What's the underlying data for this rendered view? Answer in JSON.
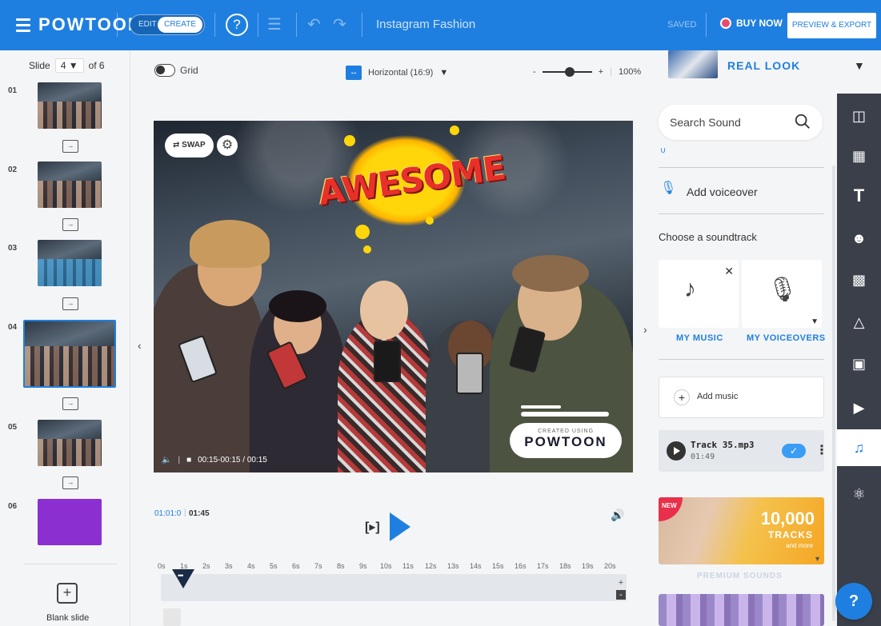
{
  "topbar": {
    "logo": "POWTOON",
    "mode_edit": "EDIT",
    "mode_create": "CREATE",
    "help": "?",
    "project_title": "Instagram Fashion",
    "saved": "SAVED",
    "buy_now": "BUY NOW",
    "preview_export": "PREVIEW & EXPORT",
    "brand_color": "#1f7fe0"
  },
  "slides": {
    "label": "Slide",
    "current": "4 ▼",
    "of": "of 6",
    "items": [
      {
        "num": "01",
        "style": "photo"
      },
      {
        "num": "02",
        "style": "photo"
      },
      {
        "num": "03",
        "style": "photo"
      },
      {
        "num": "04",
        "style": "photo",
        "active": true
      },
      {
        "num": "05",
        "style": "photo"
      },
      {
        "num": "06",
        "style": "purple"
      }
    ],
    "blank_slide": "Blank slide"
  },
  "canvas": {
    "grid_label": "Grid",
    "orientation": "Horizontal (16:9)",
    "zoom_minus": "-",
    "zoom_plus": "+",
    "zoom_value": "100%",
    "swap_label": "SWAP",
    "awesome_text": "AWESOME",
    "time_range": "00:15-00:15 / 00:15",
    "watermark_small": "CREATED USING",
    "watermark_big": "POWTOON"
  },
  "timeline": {
    "current": "01:01:0",
    "total": "01:45",
    "ticks": [
      "0s",
      "1s",
      "2s",
      "3s",
      "4s",
      "5s",
      "6s",
      "7s",
      "8s",
      "9s",
      "10s",
      "11s",
      "12s",
      "13s",
      "14s",
      "15s",
      "16s",
      "17s",
      "18s",
      "19s",
      "20s"
    ]
  },
  "right_panel": {
    "title": "REAL LOOK",
    "search_placeholder": "Search Sound",
    "add_voiceover": "Add voiceover",
    "choose_soundtrack": "Choose a soundtrack",
    "my_music": "MY MUSIC",
    "my_voiceovers": "MY VOICEOVERS",
    "add_music": "Add music",
    "track_name": "Track 35.mp3",
    "track_time": "01:49",
    "promo_new": "NEW",
    "promo_big": "10,000",
    "promo_sub": "TRACKS",
    "promo_more": "and more",
    "premium_sounds": "PREMIUM SOUNDS"
  },
  "icon_bar": {
    "items": [
      "layout-icon",
      "background-icon",
      "text-icon",
      "characters-icon",
      "props-icon",
      "shapes-icon",
      "media-icon",
      "video-icon",
      "music-icon",
      "specials-icon"
    ],
    "active": "music-icon"
  },
  "help_fab": "?"
}
